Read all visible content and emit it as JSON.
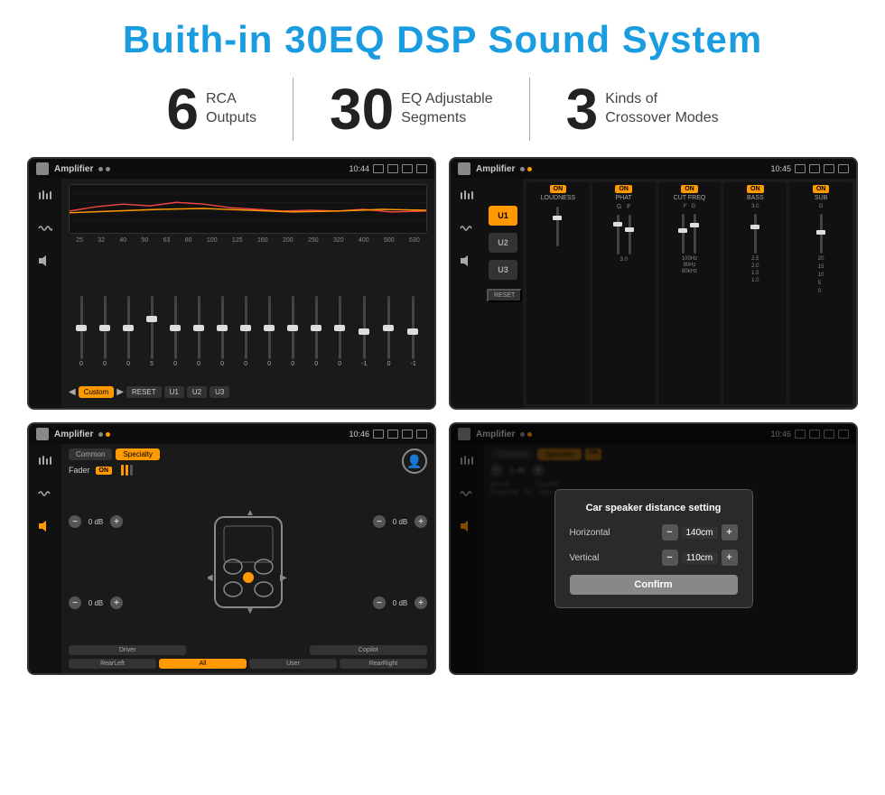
{
  "title": "Buith-in 30EQ DSP Sound System",
  "stats": [
    {
      "number": "6",
      "label": "RCA\nOutputs"
    },
    {
      "number": "30",
      "label": "EQ Adjustable\nSegments"
    },
    {
      "number": "3",
      "label": "Kinds of\nCrossover Modes"
    }
  ],
  "screens": [
    {
      "id": "screen1",
      "title": "Amplifier",
      "time": "10:44",
      "freq_labels": [
        "25",
        "32",
        "40",
        "50",
        "63",
        "80",
        "100",
        "125",
        "160",
        "200",
        "250",
        "320",
        "400",
        "500",
        "630"
      ],
      "slider_values": [
        "0",
        "0",
        "0",
        "5",
        "0",
        "0",
        "0",
        "0",
        "0",
        "0",
        "0",
        "0",
        "-1",
        "0",
        "-1"
      ],
      "bottom_btns": [
        "Custom",
        "RESET",
        "U1",
        "U2",
        "U3"
      ]
    },
    {
      "id": "screen2",
      "title": "Amplifier",
      "time": "10:45",
      "u_buttons": [
        "U1",
        "U2",
        "U3"
      ],
      "channels": [
        "LOUDNESS",
        "PHAT",
        "CUT FREQ",
        "BASS",
        "SUB"
      ],
      "reset_label": "RESET"
    },
    {
      "id": "screen3",
      "title": "Amplifier",
      "time": "10:46",
      "tabs": [
        "Common",
        "Specialty"
      ],
      "fader_label": "Fader",
      "fader_on": "ON",
      "vol_labels": [
        "0 dB",
        "0 dB",
        "0 dB",
        "0 dB"
      ],
      "btns": [
        "Driver",
        "",
        "Copilot",
        "RearLeft",
        "All",
        "User",
        "RearRight"
      ]
    },
    {
      "id": "screen4",
      "title": "Amplifier",
      "time": "10:46",
      "tabs": [
        "Common",
        "Specialty"
      ],
      "dialog": {
        "title": "Car speaker distance setting",
        "horizontal_label": "Horizontal",
        "horizontal_val": "140cm",
        "vertical_label": "Vertical",
        "vertical_val": "110cm",
        "confirm_label": "Confirm"
      },
      "vol_labels": [
        "0 dB",
        "0 dB"
      ],
      "btns": [
        "Driver",
        "Copilot",
        "RearLeft",
        "All",
        "User",
        "RearRight"
      ]
    }
  ]
}
